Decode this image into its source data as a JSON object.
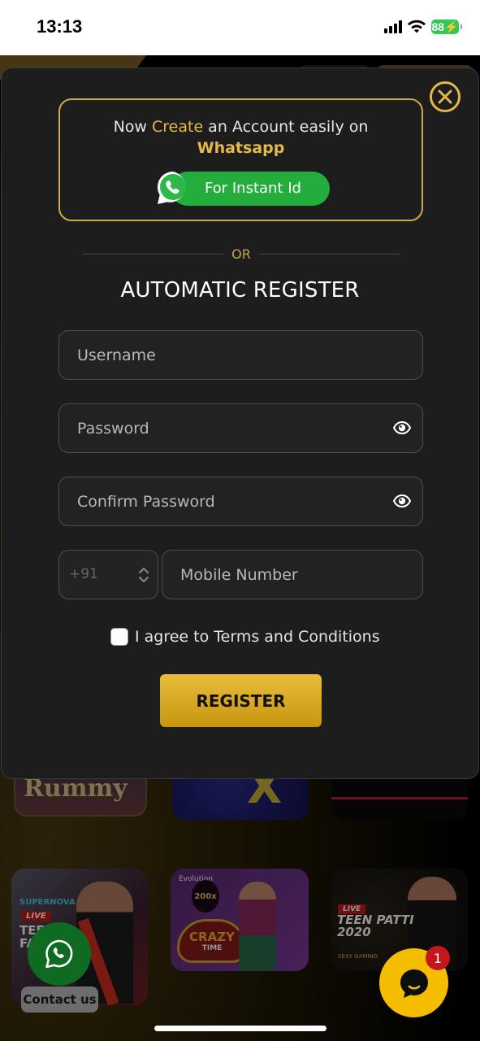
{
  "status_bar": {
    "time": "13:13",
    "battery": "88",
    "icons": [
      "signal-icon",
      "wifi-icon",
      "battery-charging-icon"
    ]
  },
  "background": {
    "tiles_row1": [
      {
        "caption": "Rummy"
      },
      {
        "caption": "X"
      },
      {
        "caption": ""
      }
    ],
    "tiles_row2": [
      {
        "tag1": "SUPERNOVA",
        "tag2": "LIVE",
        "title": "TEEN\nFA"
      },
      {
        "provider": "Evolution",
        "multiplier": "200x",
        "title": "CRAZY",
        "subtitle": "TIME"
      },
      {
        "tag": "LIVE",
        "title": "TEEN PATTI 2020",
        "brand": "SEXY GAMING"
      }
    ]
  },
  "modal": {
    "whatsapp_promo": {
      "line_prefix": "Now ",
      "line_highlight": "Create",
      "line_suffix": " an Account easily on",
      "line2": "Whatsapp",
      "button_label": "For Instant Id"
    },
    "divider_text": "OR",
    "heading": "AUTOMATIC REGISTER",
    "fields": {
      "username": {
        "placeholder": "Username",
        "value": ""
      },
      "password": {
        "placeholder": "Password",
        "value": ""
      },
      "confirm_password": {
        "placeholder": "Confirm Password",
        "value": ""
      },
      "country_code": {
        "value": "+91"
      },
      "mobile": {
        "placeholder": "Mobile Number",
        "value": ""
      }
    },
    "agree_label": "I agree to Terms and Conditions",
    "agree_checked": false,
    "register_label": "REGISTER"
  },
  "floating": {
    "contact_label": "Contact us",
    "chat_badge": "1"
  },
  "colors": {
    "accent_gold": "#e5b84a",
    "whatsapp_green": "#22ad3c",
    "chat_yellow": "#f5bd00",
    "badge_red": "#c4171c"
  }
}
